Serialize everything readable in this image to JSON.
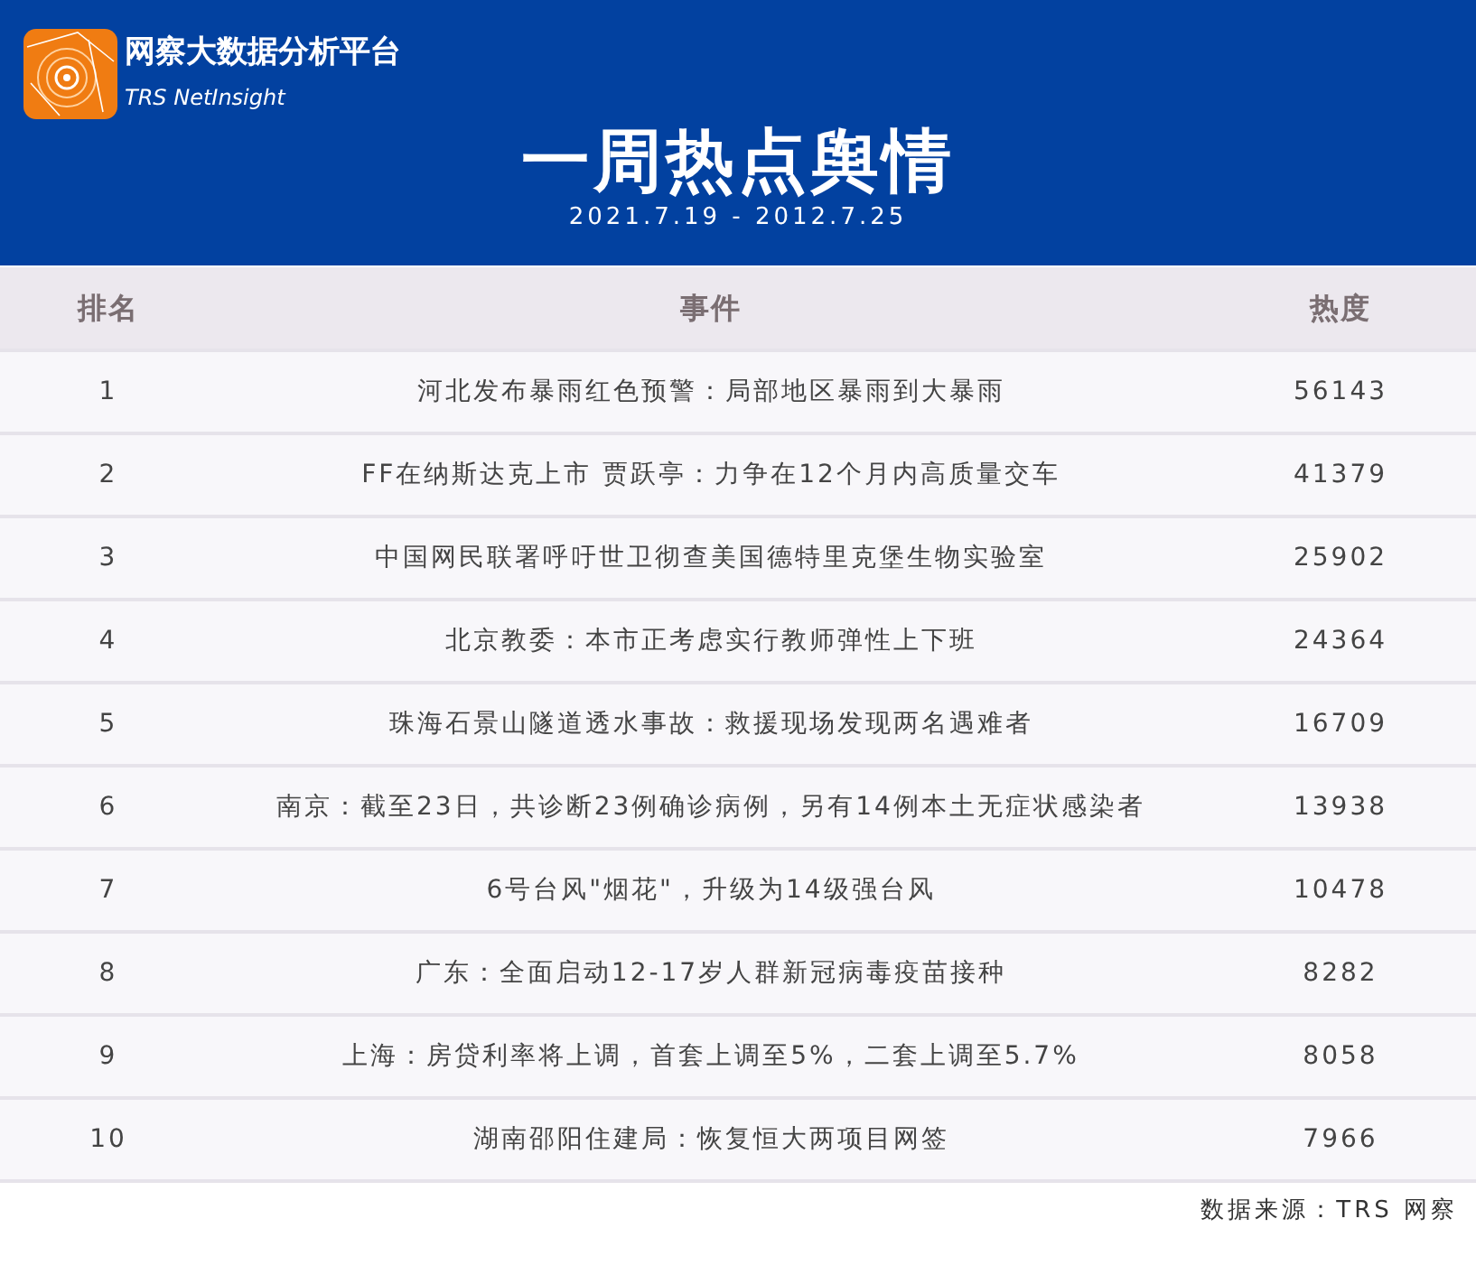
{
  "brand": {
    "name": "网察大数据分析平台",
    "subtitle": "TRS NetInsight"
  },
  "title": "一周热点舆情",
  "date_range": "2021.7.19 - 2012.7.25",
  "table": {
    "columns": [
      "排名",
      "事件",
      "热度"
    ],
    "rows": [
      [
        "1",
        "河北发布暴雨红色预警：局部地区暴雨到大暴雨",
        "56143"
      ],
      [
        "2",
        "FF在纳斯达克上市 贾跃亭：力争在12个月内高质量交车",
        "41379"
      ],
      [
        "3",
        "中国网民联署呼吁世卫彻查美国德特里克堡生物实验室",
        "25902"
      ],
      [
        "4",
        "北京教委：本市正考虑实行教师弹性上下班",
        "24364"
      ],
      [
        "5",
        "珠海石景山隧道透水事故：救援现场发现两名遇难者",
        "16709"
      ],
      [
        "6",
        "南京：截至23日，共诊断23例确诊病例，另有14例本土无症状感染者",
        "13938"
      ],
      [
        "7",
        "6号台风\"烟花\"，升级为14级强台风",
        "10478"
      ],
      [
        "8",
        "广东：全面启动12-17岁人群新冠病毒疫苗接种",
        "8282"
      ],
      [
        "9",
        "上海：房贷利率将上调，首套上调至5%，二套上调至5.7%",
        "8058"
      ],
      [
        "10",
        "湖南邵阳住建局：恢复恒大两项目网签",
        "7966"
      ]
    ]
  },
  "source": "数据来源：TRS 网察"
}
